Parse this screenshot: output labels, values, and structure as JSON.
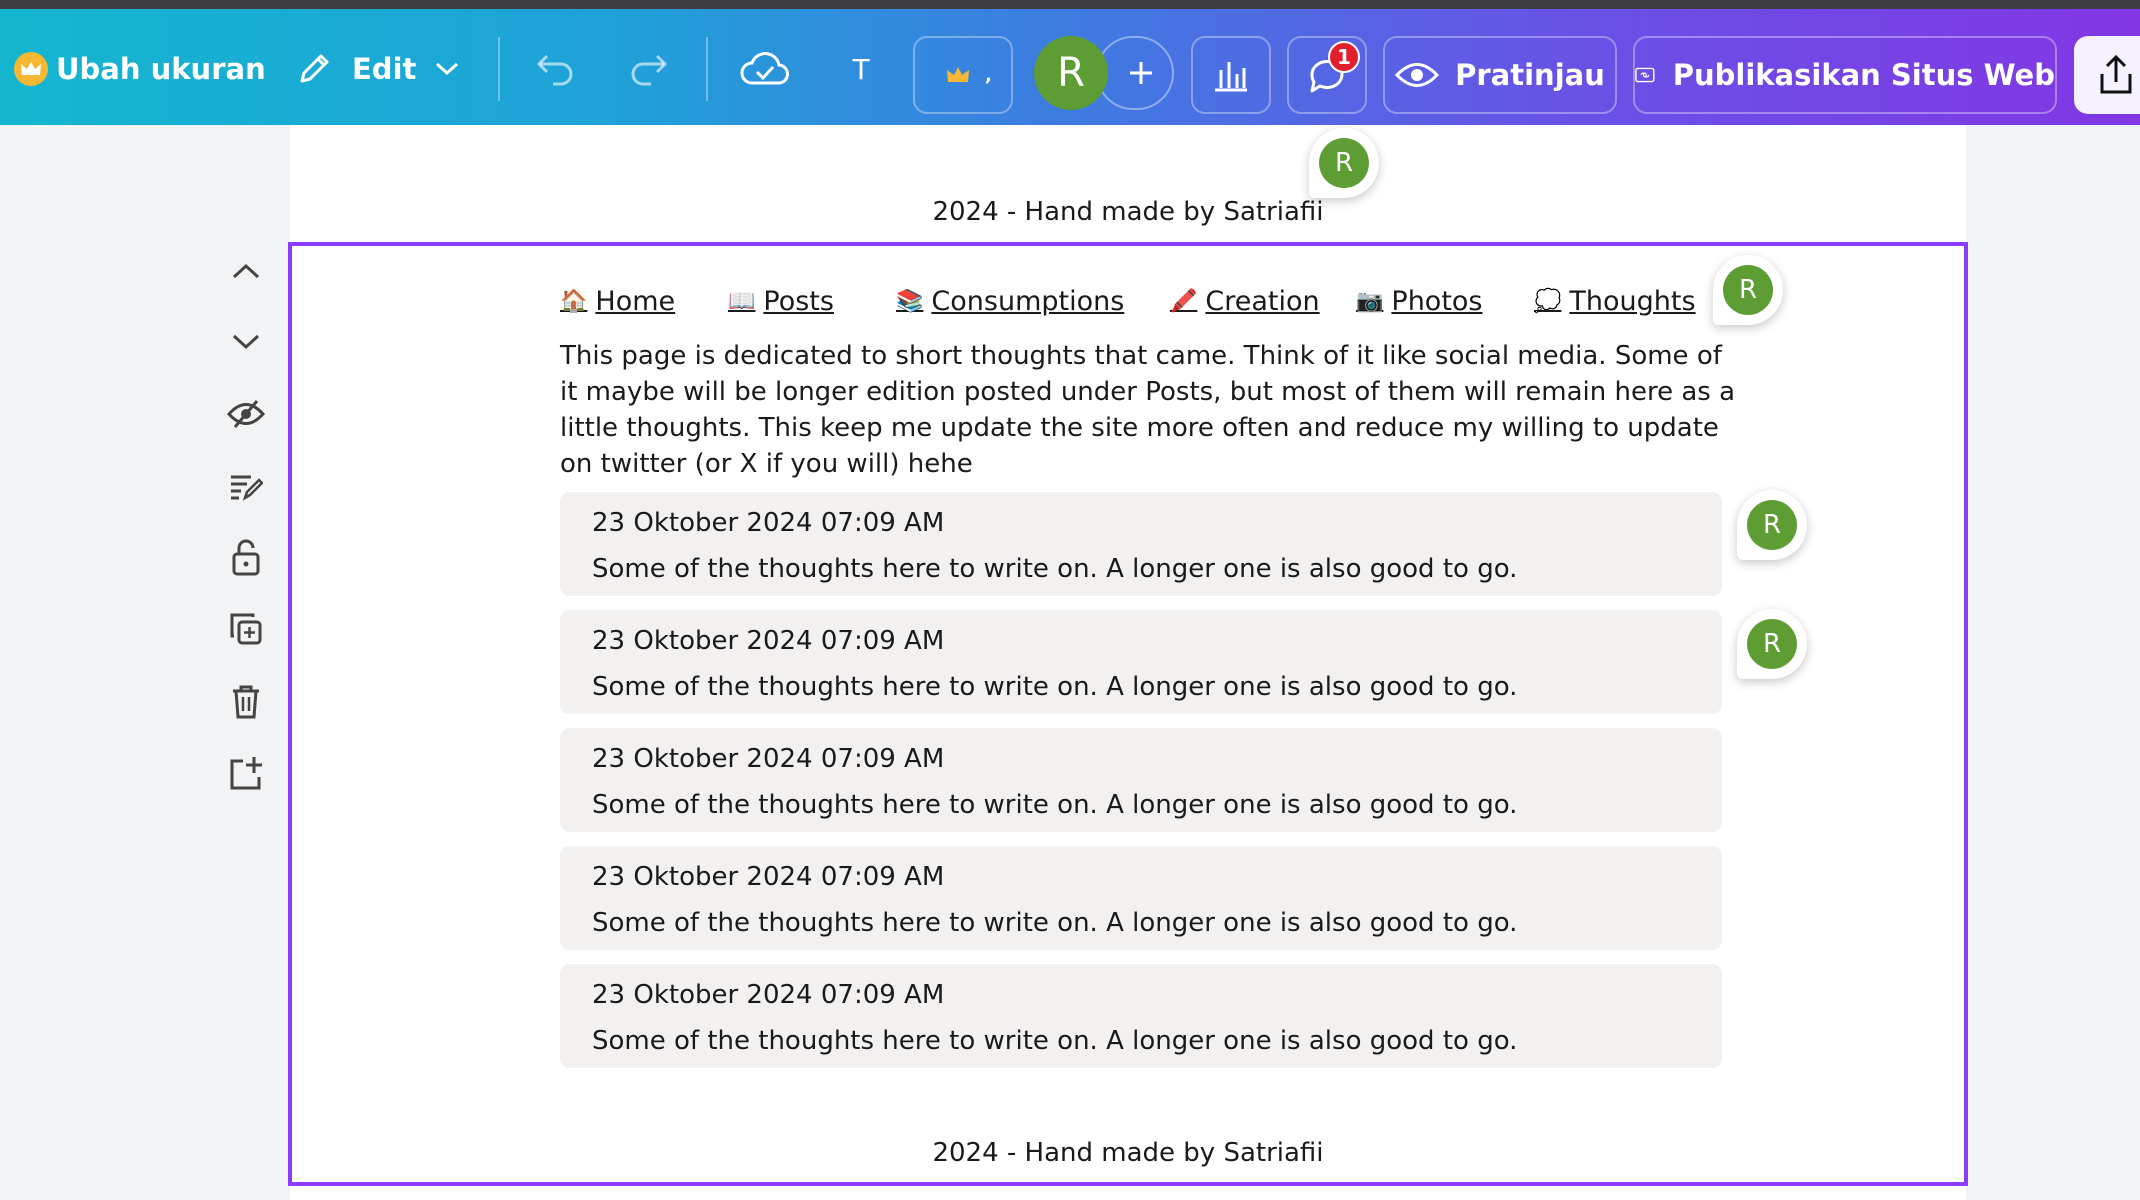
{
  "toolbar": {
    "resize_label": "Ubah ukuran",
    "edit_label": "Edit",
    "collab_avatar_initial": "R",
    "notification_count": "1",
    "preview_label": "Pratinjau",
    "publish_label": "Publikasikan Situs Web",
    "text_tool_glyph": "T"
  },
  "colors": {
    "selection": "#8b3dff",
    "avatar": "#5e9c34",
    "badge": "#e2202d",
    "card_bg": "#f3f1f0"
  },
  "rail": {
    "icons": [
      "chevron-up-icon",
      "chevron-down-icon",
      "hide-icon",
      "notes-icon",
      "lock-icon",
      "duplicate-icon",
      "trash-icon",
      "add-page-icon"
    ]
  },
  "page": {
    "prev_footer": "2024 - Hand made by Satriafii",
    "nav": [
      {
        "emoji": "🏠",
        "label": "Home"
      },
      {
        "emoji": "📖",
        "label": "Posts"
      },
      {
        "emoji": "📚",
        "label": "Consumptions"
      },
      {
        "emoji": "🖍️",
        "label": "Creation"
      },
      {
        "emoji": "📷",
        "label": "Photos"
      },
      {
        "emoji": "💭",
        "label": "Thoughts"
      }
    ],
    "intro": "This page is dedicated to short thoughts that came. Think of it like social media. Some of it maybe will be longer edition posted under Posts, but most of them will remain here as a little thoughts. This keep me update the site more often and reduce my willing to update on twitter (or X if you will) hehe",
    "posts": [
      {
        "date": "23 Oktober 2024 07:09 AM",
        "body": "Some of the thoughts here to write on. A longer one is also good to go."
      },
      {
        "date": "23 Oktober 2024 07:09 AM",
        "body": "Some of the thoughts here to write on. A longer one is also good to go."
      },
      {
        "date": "23 Oktober 2024 07:09 AM",
        "body": "Some of the thoughts here to write on. A longer one is also good to go."
      },
      {
        "date": "23 Oktober 2024 07:09 AM",
        "body": "Some of the thoughts here to write on. A longer one is also good to go."
      },
      {
        "date": "23 Oktober 2024 07:09 AM",
        "body": "Some of the thoughts here to write on. A longer one is also good to go."
      }
    ],
    "footer": "2024 - Hand made by Satriafii"
  },
  "comment_pins": [
    {
      "initial": "R"
    },
    {
      "initial": "R"
    },
    {
      "initial": "R"
    },
    {
      "initial": "R"
    }
  ]
}
